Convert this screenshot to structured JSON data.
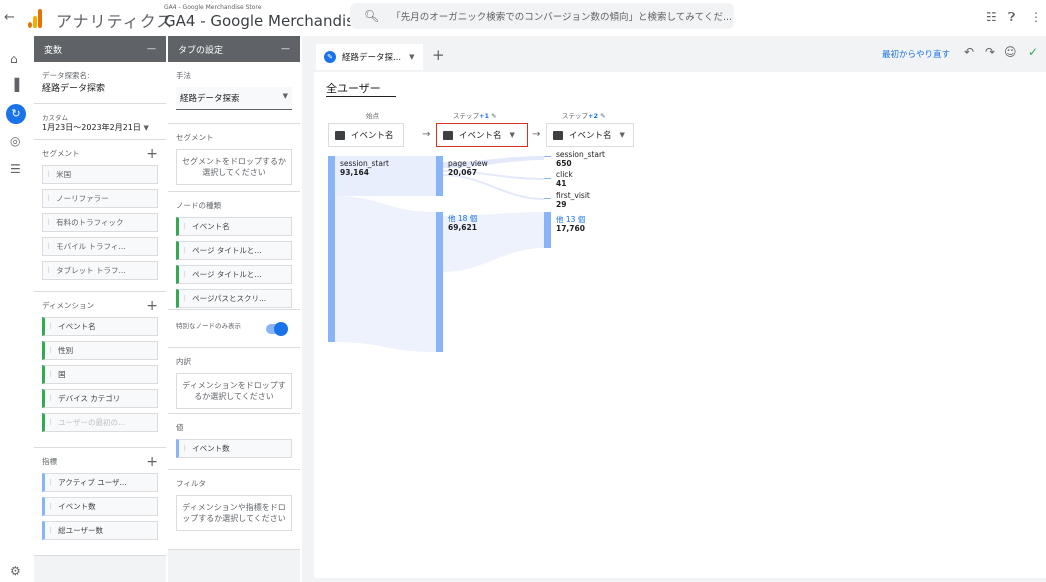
{
  "topbar": {
    "back_icon": "←",
    "app_name": "アナリティクス",
    "property_account": "GA4 - Google Merchandise Store",
    "property_name": "GA4 - Google Merchandise ...",
    "search_placeholder": "「先月のオーガニック検索でのコンバージョン数の傾向」と検索してみてくだ...",
    "icons": [
      "apps-icon",
      "help-icon",
      "more-vert-icon"
    ]
  },
  "rail": {
    "icons": [
      "home-icon",
      "reports-icon",
      "explore-icon",
      "advertising-icon",
      "configure-icon",
      "settings-icon"
    ]
  },
  "variables": {
    "header": "変数",
    "collapse": "—",
    "exploration_name_label": "データ探索名:",
    "exploration_name": "経路データ探索",
    "date_label": "カスタム",
    "date_range": "1月23日～2023年2月21日",
    "segments_title": "セグメント",
    "segments": [
      "米国",
      "ノーリファラー",
      "有料のトラフィック",
      "モバイル トラフィ...",
      "タブレット トラフ..."
    ],
    "dimensions_title": "ディメンション",
    "dimensions": [
      "イベント名",
      "性別",
      "国",
      "デバイス カテゴリ",
      "ユーザーの最初の..."
    ],
    "metrics_title": "指標",
    "metrics": [
      "アクティブ ユーザ...",
      "イベント数",
      "総ユーザー数"
    ]
  },
  "tab_settings": {
    "header": "タブの設定",
    "collapse": "—",
    "technique_label": "手法",
    "technique_value": "経路データ探索",
    "segment_title": "セグメント",
    "segment_drop": "セグメントをドロップするか選択してください",
    "node_type_title": "ノードの種類",
    "node_types": [
      "イベント名",
      "ページ タイトルと...",
      "ページ タイトルと...",
      "ページパスとスクリ..."
    ],
    "unique_nodes_label": "特別なノードのみ表示",
    "breakdown_title": "内訳",
    "breakdown_drop": "ディメンションをドロップするか選択してください",
    "values_title": "値",
    "values_chip": "イベント数",
    "filter_title": "フィルタ",
    "filter_drop": "ディメンションや指標をドロップするか選択してください"
  },
  "main": {
    "tab_label": "経路データ探...",
    "restart": "最初からやり直す",
    "segment_title": "全ユーザー",
    "columns": [
      {
        "label": "始点",
        "node": "イベント名"
      },
      {
        "label_prefix": "ステップ",
        "label_num": "+1",
        "node": "イベント名"
      },
      {
        "label_prefix": "ステップ",
        "label_num": "+2",
        "node": "イベント名"
      }
    ],
    "nodes": {
      "start": [
        {
          "name": "session_start",
          "value": "93,164"
        }
      ],
      "step1": [
        {
          "name": "page_view",
          "value": "20,067"
        },
        {
          "name": "他 18 個",
          "value": "69,621"
        }
      ],
      "step2": [
        {
          "name": "session_start",
          "value": "650"
        },
        {
          "name": "click",
          "value": "41"
        },
        {
          "name": "first_visit",
          "value": "29"
        },
        {
          "name": "他 13 個",
          "value": "17,760"
        }
      ]
    },
    "colors": {
      "bar": "#8ab4f8",
      "flow": "#e8eefc",
      "accent": "#1a73e8",
      "selected_border": "#d93025"
    }
  }
}
